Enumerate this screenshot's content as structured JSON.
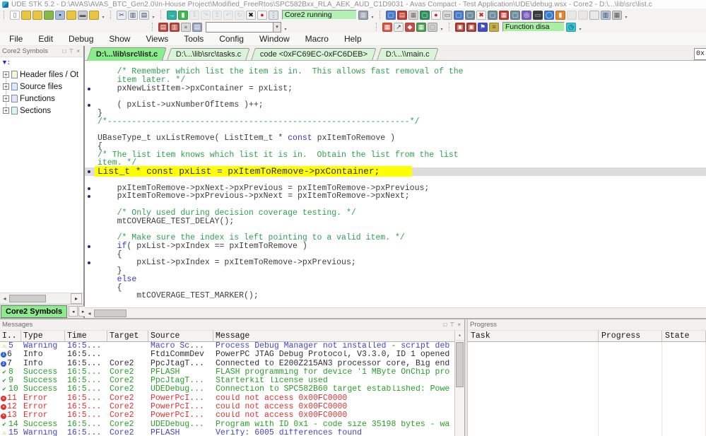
{
  "window": {
    "title": "UDE STK 5.2 - D:\\AVAS\\AVAS_BTC_Gen2.0\\In-House Project\\Modified_FreeRtos\\SPC582Bxx_RLA_AEK_AUD_C1D9031 - Avas Compact - Test Application\\UDE\\debug.wsx - Core2 - D:\\...\\lib\\src\\list.c"
  },
  "menu": [
    "File",
    "Edit",
    "Debug",
    "Show",
    "Views",
    "Tools",
    "Config",
    "Window",
    "Macro",
    "Help"
  ],
  "toolbar": {
    "core_status": "Core2 running",
    "function_status": "Function disa",
    "row1": [
      {
        "grip": true,
        "items": [
          {
            "n": "new-file",
            "bg": "#fdfdfd",
            "ch": "▯",
            "fg": "#667"
          },
          {
            "n": "open-folder",
            "bg": "#e9c63f"
          },
          {
            "n": "import-folder",
            "bg": "#e9c63f"
          },
          {
            "n": "refresh-workspace",
            "bg": "#86b945"
          },
          {
            "n": "save",
            "bg": "#a9bcd9",
            "ch": "▪",
            "fg": "#223"
          },
          {
            "n": "open-workspace",
            "bg": "#e9c63f"
          },
          {
            "n": "print",
            "bg": "#cbcbcb",
            "ch": "▬",
            "fg": "#556"
          },
          {
            "n": "export-folder",
            "bg": "#e9c63f"
          },
          {
            "t": "ovf"
          }
        ]
      },
      {
        "grip": true,
        "items": [
          {
            "n": "cut",
            "bg": "#e8edf5",
            "ch": "✂",
            "fg": "#345"
          },
          {
            "n": "copy",
            "bg": "#e8edf5",
            "ch": "▥",
            "fg": "#345"
          },
          {
            "n": "paste",
            "bg": "#e8edf5",
            "ch": "▤",
            "fg": "#345"
          },
          {
            "t": "ovf"
          }
        ]
      },
      {
        "grip": true,
        "items": [
          {
            "n": "run-continue",
            "bg": "#2cb3a2",
            "ch": "→",
            "fg": "#fff"
          },
          {
            "n": "run-to-cursor",
            "bg": "#3dbb52",
            "ch": "▮",
            "fg": "#fff"
          },
          {
            "n": "step-into",
            "bg": "#dfe3ea",
            "ch": "↧",
            "fg": "#889",
            "gr": true
          },
          {
            "n": "step-over",
            "bg": "#dfe3ea",
            "ch": "↷",
            "fg": "#889",
            "gr": true
          },
          {
            "n": "step-out",
            "bg": "#dfe3ea",
            "ch": "↥",
            "fg": "#889",
            "gr": true
          },
          {
            "n": "step-return",
            "bg": "#dfe3ea",
            "ch": "↶",
            "fg": "#889",
            "gr": true
          },
          {
            "n": "restart",
            "bg": "#dfe3ea",
            "ch": "↻",
            "fg": "#889",
            "gr": true
          },
          {
            "n": "stop-debug",
            "bg": "#f4f4f4",
            "ch": "✖",
            "fg": "#111"
          },
          {
            "n": "breakpoint-toggle",
            "bg": "#f4f4f4",
            "ch": "●",
            "fg": "#c22"
          },
          {
            "n": "step-count",
            "bg": "#dfe3ea",
            "ch": "⋮",
            "fg": "#667"
          }
        ]
      },
      {
        "items": [
          {
            "t": "field",
            "n": "core-status-field",
            "bind": "toolbar.core_status",
            "bg": "#b2f1b4",
            "w": 106
          },
          {
            "n": "target-chip",
            "bg": "#9aa4ad",
            "ch": "▦",
            "fg": "#dde"
          },
          {
            "t": "ovf"
          }
        ]
      },
      {
        "grip": true,
        "items": [
          {
            "n": "debug-config",
            "bg": "#4a7ad0",
            "ch": "▢",
            "fg": "#cdf"
          },
          {
            "n": "manual-book",
            "bg": "#bb3b31",
            "ch": "▤",
            "fg": "#fdd"
          },
          {
            "n": "schedule",
            "bg": "#d9d9d9",
            "ch": "▦",
            "fg": "#766"
          },
          {
            "n": "monitor-target",
            "bg": "#2f8f5f",
            "ch": "▢",
            "fg": "#bfd"
          },
          {
            "n": "record-dot",
            "bg": "#f4f4f4",
            "ch": "●",
            "fg": "#c22"
          },
          {
            "n": "message-box",
            "bg": "#d9d9d9",
            "ch": "▭",
            "fg": "#556"
          },
          {
            "n": "monitor-config",
            "bg": "#4a7ad0",
            "ch": "▢",
            "fg": "#cdf"
          },
          {
            "n": "monitor-sync",
            "bg": "#6e8f9e",
            "ch": "▢",
            "fg": "#dee"
          },
          {
            "n": "disconnect",
            "bg": "#f4f4f4",
            "ch": "✖",
            "fg": "#c22"
          },
          {
            "n": "monitor-watch",
            "bg": "#6e8f9e",
            "ch": "▢",
            "fg": "#dee"
          },
          {
            "n": "memory-grid",
            "bg": "#bb3b31",
            "ch": "▦",
            "fg": "#fff"
          },
          {
            "n": "monitor-alt",
            "bg": "#6e8f9e",
            "ch": "▢",
            "fg": "#dee"
          },
          {
            "n": "search-view",
            "bg": "#7a5bc8",
            "ch": "◎",
            "fg": "#fff"
          },
          {
            "n": "laptop",
            "bg": "#3b3b3b",
            "ch": "▭",
            "fg": "#9cf"
          },
          {
            "n": "web-globe",
            "bg": "#3b77d8",
            "ch": "◯",
            "fg": "#cfe"
          },
          {
            "n": "chart-view",
            "bg": "#e2862c",
            "ch": "▮",
            "fg": "#fff"
          },
          {
            "n": "window-a",
            "bg": "#d4d4d4",
            "gr": true
          },
          {
            "n": "window-b",
            "bg": "#d4d4d4",
            "gr": true
          },
          {
            "n": "window-c",
            "bg": "#e8e8e8"
          },
          {
            "n": "window-split",
            "bg": "#b9c9da",
            "ch": "▥",
            "fg": "#346"
          },
          {
            "n": "window-wizard",
            "bg": "#cccccc",
            "ch": "▦",
            "fg": "#555"
          },
          {
            "t": "ovf"
          }
        ]
      }
    ],
    "row2": [
      {
        "space": 210
      },
      {
        "grip": true,
        "items": [
          {
            "n": "watch-window",
            "bg": "#b8453a",
            "ch": "▤",
            "fg": "#fff"
          },
          {
            "n": "memory-window",
            "bg": "#b8453a",
            "ch": "▥",
            "fg": "#fff"
          },
          {
            "n": "halt-indicator",
            "bg": "#d9d9d9",
            "ch": "●",
            "fg": "#9a9a9a"
          },
          {
            "n": "symbols-window",
            "bg": "#9aa3c0",
            "ch": "▤",
            "fg": "#fff"
          }
        ]
      },
      {
        "items": [
          {
            "t": "combo",
            "n": "watch-expression-combo"
          },
          {
            "t": "ovf"
          }
        ]
      },
      {
        "space": 118
      },
      {
        "grip": true,
        "items": [
          {
            "n": "todo-list",
            "bg": "#de5242",
            "ch": "▦",
            "fg": "#fff"
          },
          {
            "n": "pointer-tool",
            "bg": "#ececec",
            "ch": "↗",
            "fg": "#333"
          },
          {
            "n": "trigger-tool",
            "bg": "#cc4a3f",
            "ch": "◆",
            "fg": "#fff"
          },
          {
            "n": "macro-record",
            "bg": "#4aa04e",
            "ch": "▦",
            "fg": "#fff"
          },
          {
            "n": "macro-disabled",
            "bg": "#cfcfcf",
            "ch": "▢",
            "fg": "#999"
          },
          {
            "t": "ovf"
          }
        ]
      },
      {
        "grip": true,
        "items": [
          {
            "n": "find-in-files",
            "bg": "#b2382e",
            "ch": "▣",
            "fg": "#fff"
          },
          {
            "n": "find-symbol",
            "bg": "#b2382e",
            "ch": "▣",
            "fg": "#fff"
          },
          {
            "n": "bookmark-flag",
            "bg": "#3f4ec4",
            "ch": "⚑",
            "fg": "#fff"
          },
          {
            "n": "list-view",
            "bg": "#c4ad43",
            "ch": "≡",
            "fg": "#554"
          }
        ]
      },
      {
        "items": [
          {
            "t": "field",
            "n": "function-status-field",
            "bind": "toolbar.function_status",
            "bg": "#a9efa2",
            "w": 88
          },
          {
            "n": "timer-clock",
            "bg": "#38c4d8",
            "ch": "◷",
            "fg": "#033"
          },
          {
            "t": "ovf"
          }
        ]
      }
    ]
  },
  "tabs": [
    {
      "label": "D:\\...\\lib\\src\\list.c",
      "active": true
    },
    {
      "label": "D:\\...\\lib\\src\\tasks.c",
      "active": false
    },
    {
      "label": "code <0xFC69EC-0xFC6DEB>",
      "active": false
    },
    {
      "label": "D:\\...\\\\main.c",
      "active": false
    }
  ],
  "address_box": "0x",
  "symbols_panel": {
    "title": "Core2 Symbols",
    "filter": "▼:",
    "items": [
      {
        "label": "Header files / Ot",
        "tint": "#fdf4cf"
      },
      {
        "label": "Source files",
        "tint": "#dfe9fb"
      },
      {
        "label": "Functions",
        "tint": "#e9e2fa"
      },
      {
        "label": "Sections",
        "tint": "#e2f2ef"
      }
    ],
    "bottom_tab": "Core2 Symbols"
  },
  "editor": {
    "lines": [
      {
        "t": "    /* Remember which list the item is in.  This allows fast removal of the",
        "k": "c"
      },
      {
        "t": "    item later. */",
        "k": "c"
      },
      {
        "t": "    pxNewListItem->pxContainer = pxList;",
        "b": 1
      },
      {
        "t": ""
      },
      {
        "t": "    ( pxList->uxNumberOfItems )++;",
        "b": 1
      },
      {
        "t": "}"
      },
      {
        "t": "/*--------------------------------------------------------------*/",
        "k": "c"
      },
      {
        "t": ""
      },
      {
        "t": "UBaseType_t uxListRemove( ListItem_t * const pxItemToRemove )"
      },
      {
        "t": "{"
      },
      {
        "t": "/* The list item knows which list it is in.  Obtain the list from the list",
        "k": "c"
      },
      {
        "t": "item. */",
        "k": "c"
      },
      {
        "t": "List_t * const pxList = pxItemToRemove->pxContainer;",
        "b": 1,
        "h": 1
      },
      {
        "t": ""
      },
      {
        "t": "    pxItemToRemove->pxNext->pxPrevious = pxItemToRemove->pxPrevious;",
        "b": 1
      },
      {
        "t": "    pxItemToRemove->pxPrevious->pxNext = pxItemToRemove->pxNext;",
        "b": 1
      },
      {
        "t": ""
      },
      {
        "t": "    /* Only used during decision coverage testing. */",
        "k": "c"
      },
      {
        "t": "    mtCOVERAGE_TEST_DELAY();"
      },
      {
        "t": ""
      },
      {
        "t": "    /* Make sure the index is left pointing to a valid item. */",
        "k": "c"
      },
      {
        "t": "    if( pxList->pxIndex == pxItemToRemove )",
        "b": 1
      },
      {
        "t": "    {"
      },
      {
        "t": "        pxList->pxIndex = pxItemToRemove->pxPrevious;",
        "b": 1
      },
      {
        "t": "    }"
      },
      {
        "t": "    else"
      },
      {
        "t": "    {"
      },
      {
        "t": "        mtCOVERAGE_TEST_MARKER();"
      }
    ]
  },
  "messages": {
    "title": "Messages",
    "columns": [
      "I..",
      "Type",
      "Time",
      "Target",
      "Source",
      "Message"
    ],
    "rows": [
      {
        "num": "5",
        "severity": "warning",
        "type": "Warning",
        "time": "16:5...",
        "target": "",
        "source": "Macro Sc...",
        "message": "Process Debug Manager not installed - script deb"
      },
      {
        "num": "6",
        "severity": "info",
        "type": "Info",
        "time": "16:5...",
        "target": "",
        "source": "FtdiCommDev",
        "message": "PowerPC JTAG Debug Protocol, V3.3.0, ID 1 opened"
      },
      {
        "num": "7",
        "severity": "info",
        "type": "Info",
        "time": "16:5...",
        "target": "Core2",
        "source": "PpcJtagT...",
        "message": "Connected to E200Z215AN3 processor core, Big end"
      },
      {
        "num": "8",
        "severity": "success",
        "type": "Success",
        "time": "16:5...",
        "target": "Core2",
        "source": "PFLASH",
        "message": "FLASH programming for device '1 MByte OnChip pro"
      },
      {
        "num": "9",
        "severity": "success",
        "type": "Success",
        "time": "16:5...",
        "target": "Core2",
        "source": "PpcJtagT...",
        "message": "Starterkit license used"
      },
      {
        "num": "10",
        "severity": "success",
        "type": "Success",
        "time": "16:5...",
        "target": "Core2",
        "source": "UDEDebug...",
        "message": "Connection to SPC582B60 target established: Powe"
      },
      {
        "num": "11",
        "severity": "error",
        "type": "Error",
        "time": "16:5...",
        "target": "Core2",
        "source": "PowerPcI...",
        "message": "could not access 0x00FC0000"
      },
      {
        "num": "12",
        "severity": "error",
        "type": "Error",
        "time": "16:5...",
        "target": "Core2",
        "source": "PowerPcI...",
        "message": "could not access 0x00FC0000"
      },
      {
        "num": "13",
        "severity": "error",
        "type": "Error",
        "time": "16:5...",
        "target": "Core2",
        "source": "PowerPcI...",
        "message": "could not access 0x00FC0000"
      },
      {
        "num": "14",
        "severity": "success",
        "type": "Success",
        "time": "16:5...",
        "target": "Core2",
        "source": "UDEDebug...",
        "message": "Program with ID 0x1 - code size 35198 bytes - wa"
      },
      {
        "num": "15",
        "severity": "warning",
        "type": "Warning",
        "time": "16:5...",
        "target": "Core2",
        "source": "PFLASH",
        "message": "Verify: 6005 differences found"
      }
    ]
  },
  "progress": {
    "title": "Progress",
    "columns": [
      "Task",
      "Progress",
      "State"
    ]
  },
  "colors": {
    "warning": "#4343cf",
    "info": "#303030",
    "success": "#28a028",
    "error": "#e23232",
    "highlight": "#ffff00",
    "current_line": "#dcdcdc",
    "active_tab": "#8bec8b",
    "inactive_tab": "#daf4da",
    "comment": "#2fa14e",
    "keyword": "#3535e0"
  }
}
